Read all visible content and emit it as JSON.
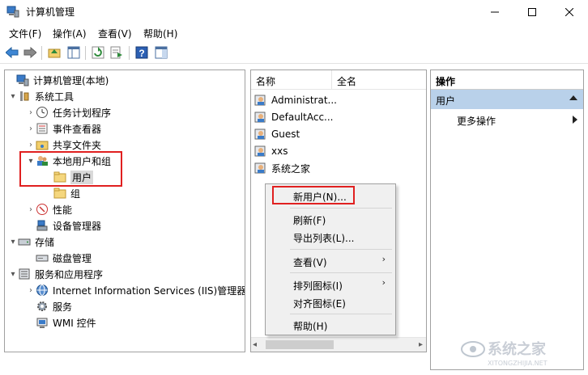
{
  "window": {
    "title": "计算机管理",
    "minimize_glyph": "—",
    "maximize_glyph": "☐",
    "close_glyph": "✕"
  },
  "menubar": [
    "文件(F)",
    "操作(A)",
    "查看(V)",
    "帮助(H)"
  ],
  "toolbar": {
    "icons": [
      "back-arrow-icon",
      "forward-arrow-icon",
      "folder-up-icon",
      "show-hide-tree-icon",
      "refresh-icon",
      "export-list-icon",
      "help-icon",
      "show-hide-action-pane-icon"
    ]
  },
  "tree": {
    "items": [
      {
        "label": "计算机管理(本地)",
        "icon": "computer-management-icon",
        "twisty": ""
      },
      {
        "label": "系统工具",
        "icon": "tools-icon",
        "twisty": "▾"
      },
      {
        "label": "任务计划程序",
        "icon": "clock-icon",
        "twisty": "›"
      },
      {
        "label": "事件查看器",
        "icon": "event-viewer-icon",
        "twisty": "›"
      },
      {
        "label": "共享文件夹",
        "icon": "shared-folder-icon",
        "twisty": "›"
      },
      {
        "label": "本地用户和组",
        "icon": "users-group-icon",
        "twisty": "▾"
      },
      {
        "label": "用户",
        "icon": "folder-icon",
        "twisty": ""
      },
      {
        "label": "组",
        "icon": "folder-icon",
        "twisty": ""
      },
      {
        "label": "性能",
        "icon": "performance-icon",
        "twisty": "›"
      },
      {
        "label": "设备管理器",
        "icon": "device-manager-icon",
        "twisty": ""
      },
      {
        "label": "存储",
        "icon": "storage-icon",
        "twisty": "▾"
      },
      {
        "label": "磁盘管理",
        "icon": "disk-icon",
        "twisty": ""
      },
      {
        "label": "服务和应用程序",
        "icon": "services-apps-icon",
        "twisty": "▾"
      },
      {
        "label": "Internet Information Services (IIS)管理器",
        "icon": "iis-icon",
        "twisty": "›"
      },
      {
        "label": "服务",
        "icon": "gear-icon",
        "twisty": ""
      },
      {
        "label": "WMI 控件",
        "icon": "wmi-icon",
        "twisty": ""
      }
    ]
  },
  "list": {
    "columns": [
      "名称",
      "全名"
    ],
    "rows": [
      "Administrat...",
      "DefaultAcc...",
      "Guest",
      "xxs",
      "系统之家"
    ],
    "scroll_left": "◂",
    "scroll_right": "▸"
  },
  "actions": {
    "header": "操作",
    "section": "用户",
    "more": "更多操作"
  },
  "context_menu": {
    "new_user": "新用户(N)...",
    "refresh": "刷新(F)",
    "export": "导出列表(L)...",
    "view": "查看(V)",
    "arrange": "排列图标(I)",
    "align": "对齐图标(E)",
    "help": "帮助(H)",
    "submenu_glyph": "›"
  },
  "colors": {
    "highlight_red": "#e02020",
    "action_section_bg": "#b9d1ea",
    "selected_bg": "#d9d9d9"
  },
  "watermark": {
    "text": "系统之家",
    "subtext": "XITONGZHIJIA.NET"
  }
}
